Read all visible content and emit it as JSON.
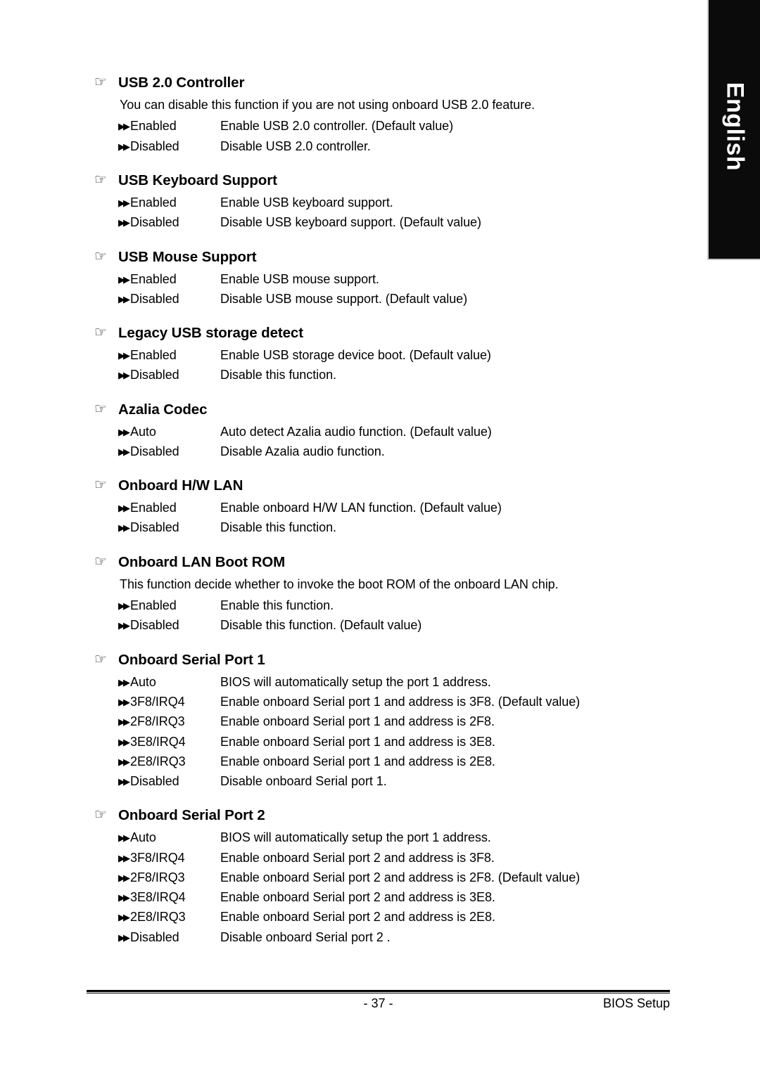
{
  "language_tab": {
    "label": "English",
    "background": "#0b0b0b",
    "text_color": "#ffffff"
  },
  "icons": {
    "manicule": "☞",
    "option_bullet": "▶▶"
  },
  "sections": [
    {
      "title": "USB 2.0 Controller",
      "description": "You can disable this function if you are not using onboard USB 2.0 feature.",
      "options": [
        {
          "name": "Enabled",
          "text": "Enable USB 2.0 controller. (Default value)"
        },
        {
          "name": "Disabled",
          "text": "Disable USB 2.0 controller."
        }
      ]
    },
    {
      "title": "USB Keyboard Support",
      "description": "",
      "options": [
        {
          "name": "Enabled",
          "text": "Enable USB keyboard support."
        },
        {
          "name": "Disabled",
          "text": "Disable USB keyboard support. (Default value)"
        }
      ]
    },
    {
      "title": "USB Mouse Support",
      "description": "",
      "options": [
        {
          "name": "Enabled",
          "text": "Enable USB mouse support."
        },
        {
          "name": "Disabled",
          "text": "Disable USB mouse support. (Default value)"
        }
      ]
    },
    {
      "title": "Legacy USB storage detect",
      "description": "",
      "options": [
        {
          "name": "Enabled",
          "text": "Enable USB storage device boot. (Default value)"
        },
        {
          "name": "Disabled",
          "text": "Disable this function."
        }
      ]
    },
    {
      "title": "Azalia Codec",
      "description": "",
      "options": [
        {
          "name": "Auto",
          "text": "Auto detect Azalia audio function. (Default value)"
        },
        {
          "name": "Disabled",
          "text": "Disable Azalia audio function."
        }
      ]
    },
    {
      "title": "Onboard H/W LAN",
      "description": "",
      "options": [
        {
          "name": "Enabled",
          "text": "Enable onboard H/W LAN function. (Default value)"
        },
        {
          "name": "Disabled",
          "text": "Disable this function."
        }
      ]
    },
    {
      "title": "Onboard LAN Boot ROM",
      "description": "This function decide whether to invoke the boot ROM of the onboard LAN chip.",
      "options": [
        {
          "name": "Enabled",
          "text": "Enable this function."
        },
        {
          "name": "Disabled",
          "text": "Disable this function. (Default value)"
        }
      ]
    },
    {
      "title": "Onboard Serial Port 1",
      "description": "",
      "options": [
        {
          "name": "Auto",
          "text": "BIOS will automatically setup the port 1 address."
        },
        {
          "name": "3F8/IRQ4",
          "text": "Enable onboard Serial port 1 and address is 3F8. (Default value)"
        },
        {
          "name": "2F8/IRQ3",
          "text": "Enable onboard Serial port 1 and address is 2F8."
        },
        {
          "name": "3E8/IRQ4",
          "text": "Enable onboard Serial port 1 and address is 3E8."
        },
        {
          "name": "2E8/IRQ3",
          "text": "Enable onboard Serial port 1 and address is 2E8."
        },
        {
          "name": "Disabled",
          "text": "Disable onboard Serial port 1."
        }
      ]
    },
    {
      "title": "Onboard Serial Port 2",
      "description": "",
      "options": [
        {
          "name": "Auto",
          "text": "BIOS will automatically setup the port 1 address."
        },
        {
          "name": "3F8/IRQ4",
          "text": "Enable onboard Serial port 2 and address is 3F8."
        },
        {
          "name": "2F8/IRQ3",
          "text": "Enable onboard Serial port 2 and address is 2F8. (Default value)"
        },
        {
          "name": "3E8/IRQ4",
          "text": "Enable onboard Serial port 2 and address is 3E8."
        },
        {
          "name": "2E8/IRQ3",
          "text": "Enable onboard Serial port 2 and address is 2E8."
        },
        {
          "name": "Disabled",
          "text": "Disable onboard Serial port 2 ."
        }
      ]
    }
  ],
  "footer": {
    "page_number": "- 37 -",
    "section_label": "BIOS Setup"
  }
}
